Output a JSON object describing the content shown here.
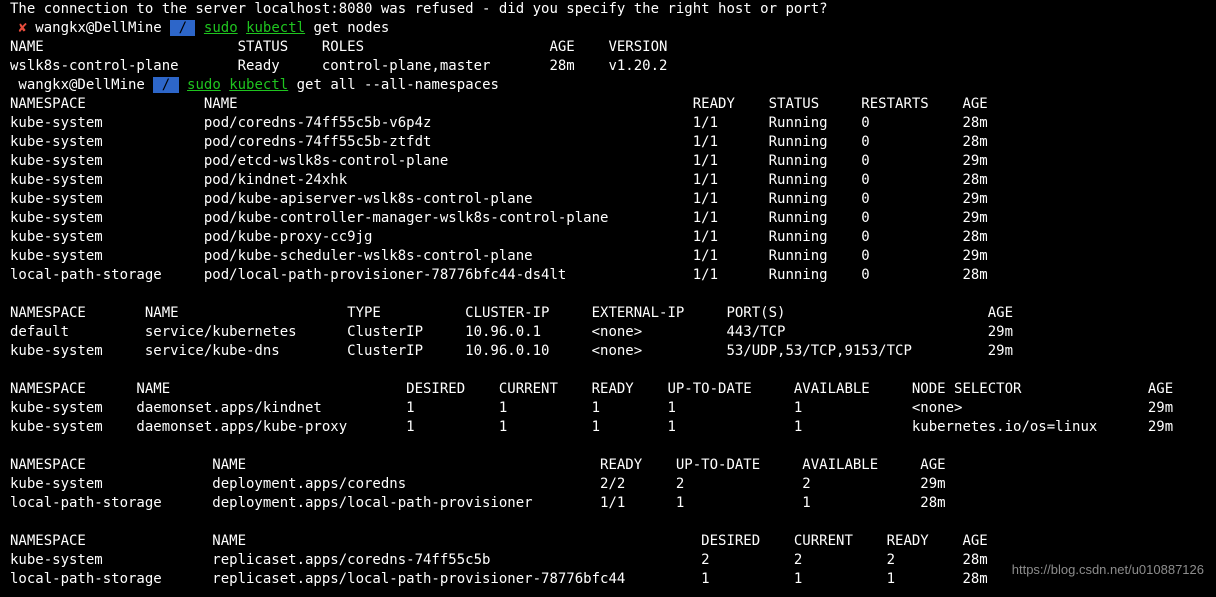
{
  "error_line": "The connection to the server localhost:8080 was refused - did you specify the right host or port?",
  "prompt1": {
    "cross": "✘",
    "user": "wangkx@DellMine",
    "path": " / ",
    "arrow": "",
    "sudo": "sudo",
    "kubectl": "kubectl",
    "rest": " get nodes"
  },
  "nodes": {
    "header": [
      "NAME",
      "STATUS",
      "ROLES",
      "AGE",
      "VERSION"
    ],
    "rows": [
      [
        "wslk8s-control-plane",
        "Ready",
        "control-plane,master",
        "28m",
        "v1.20.2"
      ]
    ]
  },
  "prompt2": {
    "user": "wangkx@DellMine",
    "path": " / ",
    "arrow": "",
    "sudo": "sudo",
    "kubectl": "kubectl",
    "rest": " get all --all-namespaces"
  },
  "pods": {
    "header": [
      "NAMESPACE",
      "NAME",
      "READY",
      "STATUS",
      "RESTARTS",
      "AGE"
    ],
    "rows": [
      [
        "kube-system",
        "pod/coredns-74ff55c5b-v6p4z",
        "1/1",
        "Running",
        "0",
        "28m"
      ],
      [
        "kube-system",
        "pod/coredns-74ff55c5b-ztfdt",
        "1/1",
        "Running",
        "0",
        "28m"
      ],
      [
        "kube-system",
        "pod/etcd-wslk8s-control-plane",
        "1/1",
        "Running",
        "0",
        "29m"
      ],
      [
        "kube-system",
        "pod/kindnet-24xhk",
        "1/1",
        "Running",
        "0",
        "28m"
      ],
      [
        "kube-system",
        "pod/kube-apiserver-wslk8s-control-plane",
        "1/1",
        "Running",
        "0",
        "29m"
      ],
      [
        "kube-system",
        "pod/kube-controller-manager-wslk8s-control-plane",
        "1/1",
        "Running",
        "0",
        "29m"
      ],
      [
        "kube-system",
        "pod/kube-proxy-cc9jg",
        "1/1",
        "Running",
        "0",
        "28m"
      ],
      [
        "kube-system",
        "pod/kube-scheduler-wslk8s-control-plane",
        "1/1",
        "Running",
        "0",
        "29m"
      ],
      [
        "local-path-storage",
        "pod/local-path-provisioner-78776bfc44-ds4lt",
        "1/1",
        "Running",
        "0",
        "28m"
      ]
    ]
  },
  "services": {
    "header": [
      "NAMESPACE",
      "NAME",
      "TYPE",
      "CLUSTER-IP",
      "EXTERNAL-IP",
      "PORT(S)",
      "AGE"
    ],
    "rows": [
      [
        "default",
        "service/kubernetes",
        "ClusterIP",
        "10.96.0.1",
        "<none>",
        "443/TCP",
        "29m"
      ],
      [
        "kube-system",
        "service/kube-dns",
        "ClusterIP",
        "10.96.0.10",
        "<none>",
        "53/UDP,53/TCP,9153/TCP",
        "29m"
      ]
    ]
  },
  "daemonsets": {
    "header": [
      "NAMESPACE",
      "NAME",
      "DESIRED",
      "CURRENT",
      "READY",
      "UP-TO-DATE",
      "AVAILABLE",
      "NODE SELECTOR",
      "AGE"
    ],
    "rows": [
      [
        "kube-system",
        "daemonset.apps/kindnet",
        "1",
        "1",
        "1",
        "1",
        "1",
        "<none>",
        "29m"
      ],
      [
        "kube-system",
        "daemonset.apps/kube-proxy",
        "1",
        "1",
        "1",
        "1",
        "1",
        "kubernetes.io/os=linux",
        "29m"
      ]
    ]
  },
  "deployments": {
    "header": [
      "NAMESPACE",
      "NAME",
      "READY",
      "UP-TO-DATE",
      "AVAILABLE",
      "AGE"
    ],
    "rows": [
      [
        "kube-system",
        "deployment.apps/coredns",
        "2/2",
        "2",
        "2",
        "29m"
      ],
      [
        "local-path-storage",
        "deployment.apps/local-path-provisioner",
        "1/1",
        "1",
        "1",
        "28m"
      ]
    ]
  },
  "replicasets": {
    "header": [
      "NAMESPACE",
      "NAME",
      "DESIRED",
      "CURRENT",
      "READY",
      "AGE"
    ],
    "rows": [
      [
        "kube-system",
        "replicaset.apps/coredns-74ff55c5b",
        "2",
        "2",
        "2",
        "28m"
      ],
      [
        "local-path-storage",
        "replicaset.apps/local-path-provisioner-78776bfc44",
        "1",
        "1",
        "1",
        "28m"
      ]
    ]
  },
  "watermark": "https://blog.csdn.net/u010887126",
  "widths": {
    "nodes": [
      27,
      10,
      27,
      7,
      10
    ],
    "pods": [
      23,
      58,
      9,
      11,
      12,
      6
    ],
    "services": [
      16,
      24,
      14,
      15,
      16,
      31,
      6
    ],
    "daemonsets": [
      15,
      32,
      11,
      11,
      9,
      15,
      14,
      28,
      6
    ],
    "deployments": [
      24,
      46,
      9,
      15,
      14,
      6
    ],
    "replicasets": [
      24,
      58,
      11,
      11,
      9,
      6
    ]
  }
}
